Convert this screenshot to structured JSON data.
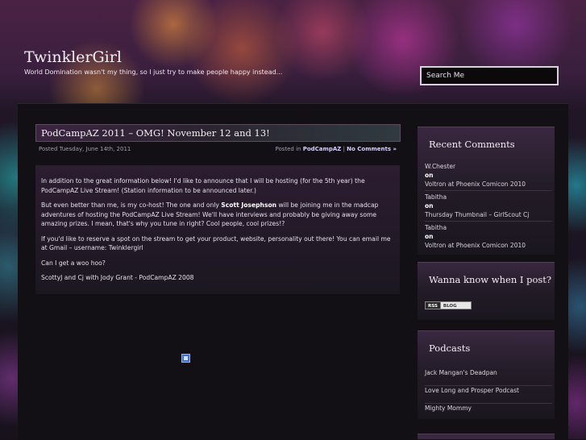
{
  "site": {
    "title": "TwinklerGirl",
    "tagline": "World Domination wasn't my thing, so I just try to make people happy instead..."
  },
  "search": {
    "placeholder": "Search Me"
  },
  "post": {
    "title": "PodCampAZ 2011 – OMG! November 12 and 13!",
    "date": "Posted Tuesday, June 14th, 2011",
    "posted_in_label": "Posted in",
    "category": "PodCampAZ",
    "separator": "|",
    "comments_link": "No Comments »",
    "paragraphs": {
      "p1": "In addition to the great information below! I'd like to announce that I will be hosting (for the 5th year) the PodCampAZ Live Stream! (Station information to be announced later.)",
      "p2_before": "But even better than me, is my co-host! The one and only ",
      "p2_name": "Scott Josephson",
      "p2_after": " will be joining me in the madcap adventures of hosting the PodCampAZ Live Stream! We'll have interviews and probably be giving away some amazing prizes. I mean, that's why you tune in right? Cool people, cool prizes!?",
      "p3": "If you'd like to reserve a spot on the stream to get your product, website, personality out there! You can email me at Gmail – username: Twinklergirl",
      "p4": "Can I get a woo hoo?",
      "p5": "ScottyJ and Cj with Jody Grant - PodCampAZ 2008"
    }
  },
  "sidebar": {
    "recent_comments": {
      "title": "Recent Comments",
      "items": [
        {
          "author": "W.Chester",
          "on": "on",
          "post": "Voltron at Phoenix Comicon 2010"
        },
        {
          "author": "Tabitha",
          "on": "on",
          "post": "Thursday Thumbnail – GirlScout Cj"
        },
        {
          "author": "Tabitha",
          "on": "on",
          "post": "Voltron at Phoenix Comicon 2010"
        }
      ]
    },
    "subscribe": {
      "title": "Wanna know when I post?",
      "rss_label": "RSS",
      "blog_label": "BLOG"
    },
    "podcasts": {
      "title": "Podcasts",
      "items": [
        "Jack Mangan's Deadpan",
        "Love Long and Prosper Podcast",
        "Mighty Mommy"
      ]
    }
  },
  "icons": {
    "image_placeholder": "broken-image-icon"
  }
}
